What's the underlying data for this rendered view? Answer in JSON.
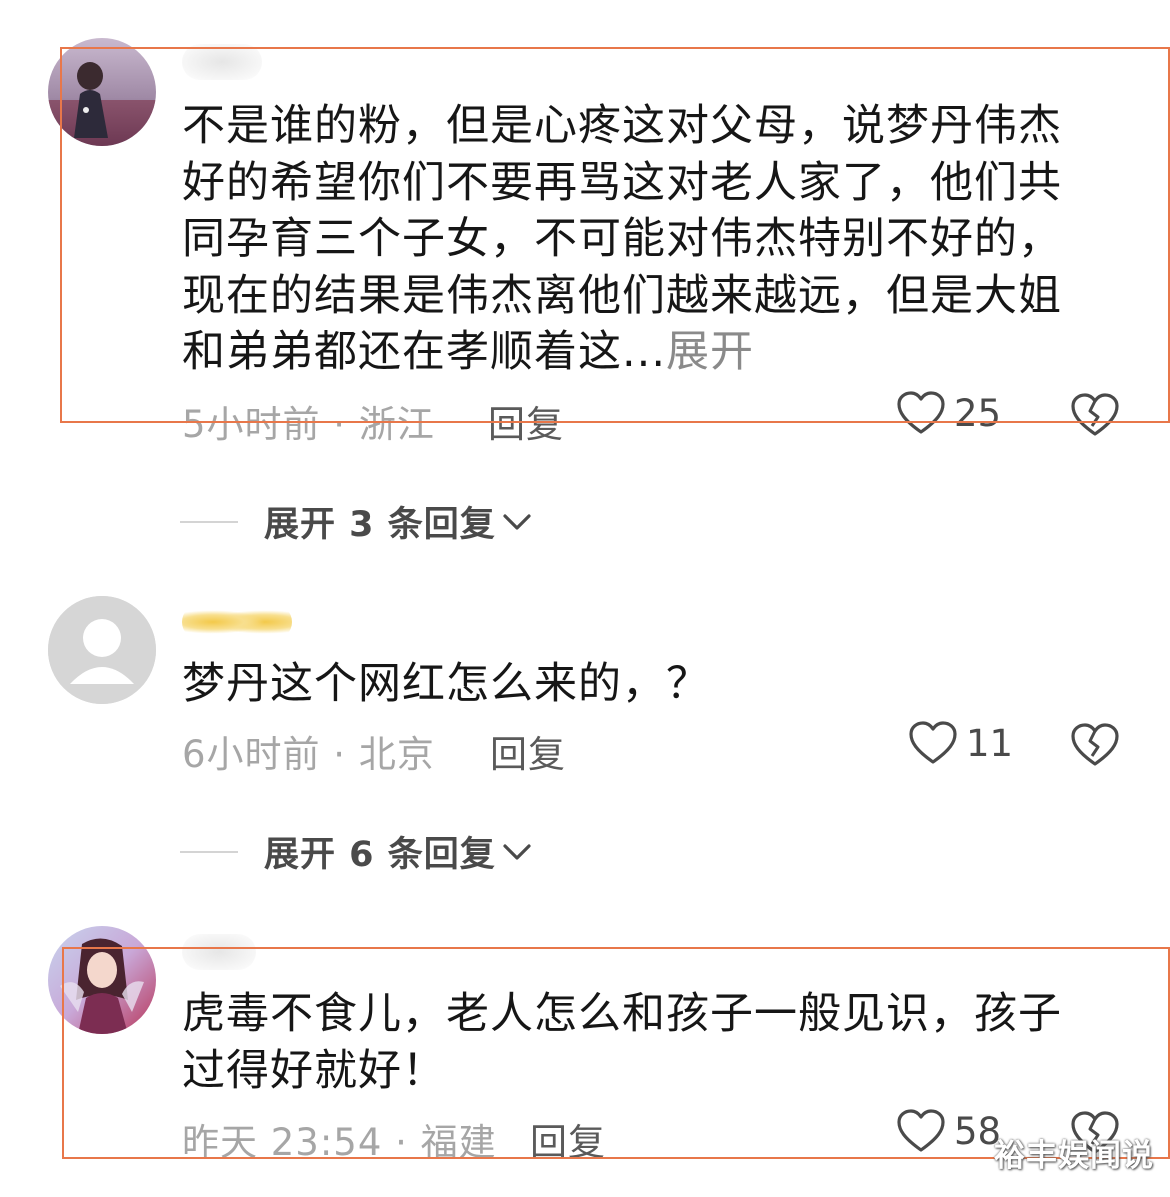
{
  "comments": [
    {
      "text": "不是谁的粉，但是心疼这对父母，说梦丹伟杰好的希望你们不要再骂这对老人家了，他们共同孕育三个子女，不可能对伟杰特别不好的，现在的结果是伟杰离他们越来越远，但是大姐和弟弟都还在孝顺着这...",
      "more_label": "展开",
      "time_location": "5小时前 · 浙江",
      "reply_label": "回复",
      "likes": "25",
      "expand_label": "展开 3 条回复"
    },
    {
      "text": "梦丹这个网红怎么来的，？",
      "time_location": "6小时前 · 北京",
      "reply_label": "回复",
      "likes": "11",
      "expand_label": "展开 6 条回复"
    },
    {
      "text": "虎毒不食儿，老人怎么和孩子一般见识，孩子过得好就好！",
      "time_location": "昨天 23:54 · 福建",
      "reply_label": "回复",
      "likes": "58"
    }
  ],
  "watermark": "裕丰娱闻说",
  "colors": {
    "highlight": "#e8774a",
    "text": "#161616",
    "meta": "#a6a6a6"
  }
}
